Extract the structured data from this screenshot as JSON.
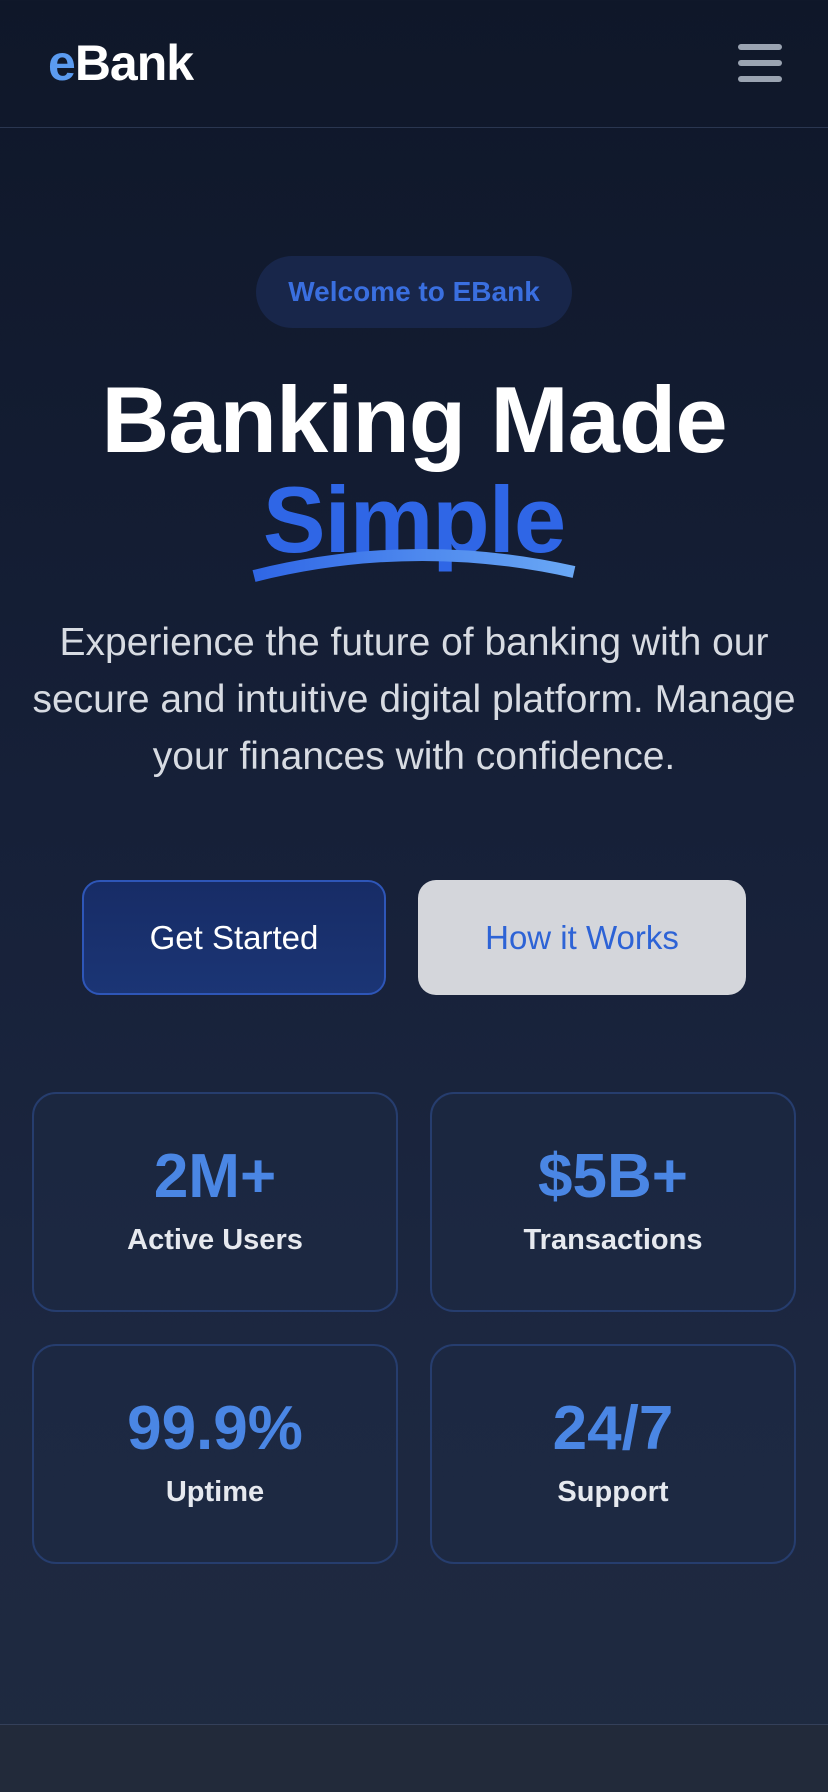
{
  "header": {
    "logo_prefix": "e",
    "logo_rest": "Bank",
    "menu_icon": "hamburger-menu-icon"
  },
  "hero": {
    "badge": "Welcome to EBank",
    "title_line1": "Banking Made",
    "title_accent": "Simple",
    "description": "Experience the future of banking with our secure and intuitive digital platform. Manage your finances with confidence."
  },
  "actions": {
    "primary_label": "Get Started",
    "secondary_label": "How it Works"
  },
  "stats": [
    {
      "value": "2M+",
      "label": "Active Users"
    },
    {
      "value": "$5B+",
      "label": "Transactions"
    },
    {
      "value": "99.9%",
      "label": "Uptime"
    },
    {
      "value": "24/7",
      "label": "Support"
    }
  ],
  "colors": {
    "accent": "#2f66e6",
    "stat_value": "#4a86e4",
    "background": "#0f1729"
  }
}
